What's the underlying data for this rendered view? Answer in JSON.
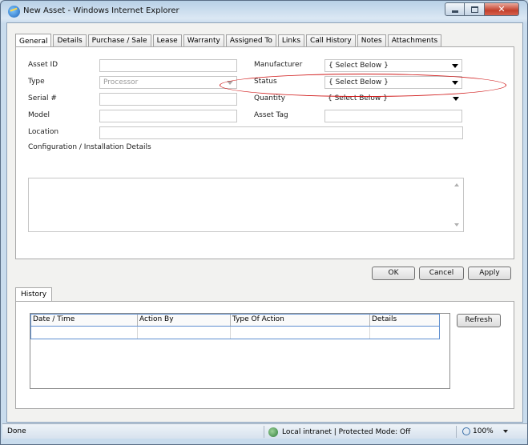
{
  "window": {
    "title": "New Asset - Windows Internet Explorer"
  },
  "tabs": [
    "General",
    "Details",
    "Purchase / Sale",
    "Lease",
    "Warranty",
    "Assigned To",
    "Links",
    "Call History",
    "Notes",
    "Attachments"
  ],
  "form": {
    "asset_id_label": "Asset ID",
    "type_label": "Type",
    "type_value": "Processor",
    "serial_label": "Serial #",
    "model_label": "Model",
    "location_label": "Location",
    "manufacturer_label": "Manufacturer",
    "manufacturer_value": "{ Select Below }",
    "status_label": "Status",
    "status_value": "{ Select Below }",
    "quantity_label": "Quantity",
    "quantity_value": "{ Select Below }",
    "asset_tag_label": "Asset Tag",
    "config_label": "Configuration / Installation Details"
  },
  "buttons": {
    "ok": "OK",
    "cancel": "Cancel",
    "apply": "Apply",
    "refresh": "Refresh"
  },
  "history": {
    "tab": "History",
    "columns": [
      "Date / Time",
      "Action By",
      "Type Of Action",
      "Details"
    ]
  },
  "statusbar": {
    "done": "Done",
    "zone": "Local intranet | Protected Mode: Off",
    "zoom": "100%"
  },
  "colors": {
    "annotation": "#d01818",
    "titlebar": "#b8d0e6"
  },
  "icons": {
    "window": "ie-icon",
    "zone": "intranet-globe-icon",
    "zoom": "magnifier-icon"
  }
}
